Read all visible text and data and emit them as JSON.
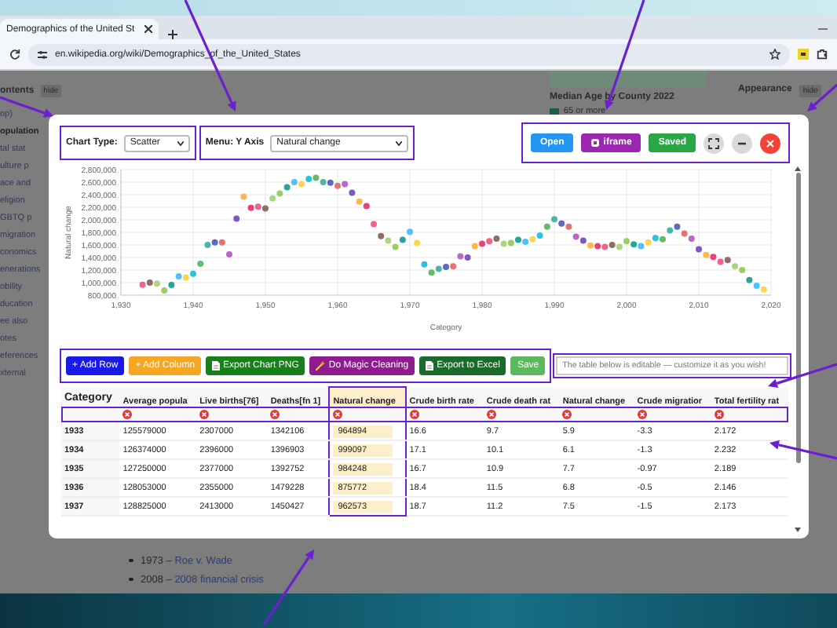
{
  "browser": {
    "tab_title": "Demographics of the United St",
    "url": "en.wikipedia.org/wiki/Demographics_of_the_United_States"
  },
  "page": {
    "contents_title": "ontents",
    "contents_hide": "hide",
    "sidebar_items": [
      {
        "label": "op)",
        "current": false
      },
      {
        "label": "opulation",
        "current": true
      },
      {
        "label": "tal stat",
        "current": false
      },
      {
        "label": "ulture p",
        "current": false
      },
      {
        "label": "ace and",
        "current": false
      },
      {
        "label": "eligion",
        "current": false
      },
      {
        "label": "GBTQ p",
        "current": false
      },
      {
        "label": "migration",
        "current": false
      },
      {
        "label": "conomics",
        "current": false
      },
      {
        "label": "enerations",
        "current": false
      },
      {
        "label": "obility",
        "current": false
      },
      {
        "label": "ducation",
        "current": false
      },
      {
        "label": "ee also",
        "current": false
      },
      {
        "label": "otes",
        "current": false
      },
      {
        "label": "eferences",
        "current": false
      },
      {
        "label": "xternal",
        "current": false
      }
    ],
    "figure_caption": "Median Age by County 2022",
    "legend_label": "65 or more",
    "appearance_title": "Appearance",
    "appearance_hide": "hide",
    "list_items": [
      {
        "prefix": "1973 –",
        "link": "Roe v. Wade"
      },
      {
        "prefix": "2008 –",
        "link": "2008 financial crisis"
      }
    ]
  },
  "modal": {
    "chart_type": {
      "label": "Chart Type:",
      "value": "Scatter",
      "framed": true
    },
    "y_axis": {
      "label": "Menu: Y Axis",
      "value": "Natural change",
      "framed": true
    },
    "header_buttons": {
      "framed": true,
      "items": [
        {
          "kind": "text",
          "label": "Open",
          "color": "#2196f3"
        },
        {
          "kind": "iframe",
          "label": "iframe",
          "color": "#9c27b0"
        },
        {
          "kind": "text",
          "label": "Saved",
          "color": "#28a745"
        },
        {
          "kind": "fullscreen",
          "color": "#d9d9d9"
        },
        {
          "kind": "minimize",
          "color": "#d9d9d9"
        },
        {
          "kind": "close",
          "color": "#f44336"
        }
      ]
    },
    "chart_data": {
      "type": "scatter",
      "grid": true,
      "xlabel": "Category",
      "ylabel": "Natural change",
      "x": [
        1933,
        1934,
        1935,
        1936,
        1937,
        1938,
        1939,
        1940,
        1941,
        1942,
        1943,
        1944,
        1945,
        1946,
        1947,
        1948,
        1949,
        1950,
        1951,
        1952,
        1953,
        1954,
        1955,
        1956,
        1957,
        1958,
        1959,
        1960,
        1961,
        1962,
        1963,
        1964,
        1965,
        1966,
        1967,
        1968,
        1969,
        1970,
        1971,
        1972,
        1973,
        1974,
        1975,
        1976,
        1977,
        1978,
        1979,
        1980,
        1981,
        1982,
        1983,
        1984,
        1985,
        1986,
        1987,
        1988,
        1989,
        1990,
        1991,
        1992,
        1993,
        1994,
        1995,
        1996,
        1997,
        1998,
        1999,
        2000,
        2001,
        2002,
        2003,
        2004,
        2005,
        2006,
        2007,
        2008,
        2009,
        2010,
        2011,
        2012,
        2013,
        2014,
        2015,
        2016,
        2017,
        2018,
        2019
      ],
      "series": [
        {
          "values": [
            965000,
            999000,
            984000,
            876000,
            963000,
            1100000,
            1080000,
            1140000,
            1300000,
            1600000,
            1640000,
            1640000,
            1450000,
            2020000,
            2370000,
            2190000,
            2210000,
            2180000,
            2340000,
            2420000,
            2520000,
            2600000,
            2570000,
            2650000,
            2670000,
            2600000,
            2590000,
            2540000,
            2570000,
            2430000,
            2290000,
            2220000,
            1930000,
            1740000,
            1670000,
            1570000,
            1680000,
            1810000,
            1630000,
            1290000,
            1160000,
            1220000,
            1250000,
            1260000,
            1420000,
            1400000,
            1580000,
            1620000,
            1660000,
            1700000,
            1620000,
            1630000,
            1680000,
            1650000,
            1690000,
            1750000,
            1890000,
            2010000,
            1940000,
            1890000,
            1730000,
            1670000,
            1590000,
            1580000,
            1570000,
            1600000,
            1570000,
            1660000,
            1610000,
            1580000,
            1640000,
            1710000,
            1690000,
            1830000,
            1890000,
            1780000,
            1700000,
            1530000,
            1440000,
            1410000,
            1330000,
            1360000,
            1260000,
            1200000,
            1040000,
            950000,
            890000
          ]
        }
      ],
      "xlim": [
        1930,
        2020
      ],
      "ylim": [
        800000,
        2800000
      ],
      "xticks": [
        {
          "value": 1930,
          "label": "1,930"
        },
        {
          "value": 1940,
          "label": "1,940"
        },
        {
          "value": 1950,
          "label": "1,950"
        },
        {
          "value": 1960,
          "label": "1,960"
        },
        {
          "value": 1970,
          "label": "1,970"
        },
        {
          "value": 1980,
          "label": "1,980"
        },
        {
          "value": 1990,
          "label": "1,990"
        },
        {
          "value": 2000,
          "label": "2,000"
        },
        {
          "value": 2010,
          "label": "2,010"
        },
        {
          "value": 2020,
          "label": "2,020"
        }
      ],
      "yticks": [
        {
          "value": 800000,
          "label": "800,000"
        },
        {
          "value": 1000000,
          "label": "1,000,000"
        },
        {
          "value": 1200000,
          "label": "1,200,000"
        },
        {
          "value": 1400000,
          "label": "1,400,000"
        },
        {
          "value": 1600000,
          "label": "1,600,000"
        },
        {
          "value": 1800000,
          "label": "1,800,000"
        },
        {
          "value": 2000000,
          "label": "2,000,000"
        },
        {
          "value": 2200000,
          "label": "2,200,000"
        },
        {
          "value": 2400000,
          "label": "2,400,000"
        },
        {
          "value": 2600000,
          "label": "2,600,000"
        },
        {
          "value": 2800000,
          "label": "2,800,000"
        }
      ]
    },
    "toolbar": {
      "framed": true,
      "buttons": [
        {
          "kind": "plain",
          "label": "+ Add Row",
          "color": "#1a1ae6"
        },
        {
          "kind": "plain",
          "label": "+ Add Column",
          "color": "#f5a623"
        },
        {
          "kind": "export",
          "label": "Export Chart PNG",
          "color": "#17801a"
        },
        {
          "kind": "magic",
          "label": "Do Magic Cleaning",
          "color": "#8e1c8e"
        },
        {
          "kind": "export",
          "label": "Export to Excel",
          "color": "#1a6b2a"
        },
        {
          "kind": "plain",
          "label": "Save",
          "color": "#5cb85c"
        }
      ]
    },
    "note": {
      "text": "The table below is editable — customize it as you wish!",
      "framed": true
    },
    "table": {
      "delete_row_framed": true,
      "columns": [
        {
          "label": "Category",
          "highlighted": false,
          "deletable": false
        },
        {
          "label": "Average popula",
          "highlighted": false,
          "deletable": true
        },
        {
          "label": "Live births[76]",
          "highlighted": false,
          "deletable": true
        },
        {
          "label": "Deaths[fn 1]",
          "highlighted": false,
          "deletable": true
        },
        {
          "label": "Natural change",
          "highlighted": true,
          "deletable": true
        },
        {
          "label": "Crude birth rate",
          "highlighted": false,
          "deletable": true
        },
        {
          "label": "Crude death rat",
          "highlighted": false,
          "deletable": true
        },
        {
          "label": "Natural change",
          "highlighted": false,
          "deletable": true
        },
        {
          "label": "Crude migratior",
          "highlighted": false,
          "deletable": true
        },
        {
          "label": "Total fertility rat",
          "highlighted": false,
          "deletable": true
        }
      ],
      "rows": [
        [
          "1933",
          "125579000",
          "2307000",
          "1342106",
          "964894",
          "16.6",
          "9.7",
          "5.9",
          "-3.3",
          "2.172"
        ],
        [
          "1934",
          "126374000",
          "2396000",
          "1396903",
          "999097",
          "17.1",
          "10.1",
          "6.1",
          "-1.3",
          "2.232"
        ],
        [
          "1935",
          "127250000",
          "2377000",
          "1392752",
          "984248",
          "16.7",
          "10.9",
          "7.7",
          "-0.97",
          "2.189"
        ],
        [
          "1936",
          "128053000",
          "2355000",
          "1479228",
          "875772",
          "18.4",
          "11.5",
          "6.8",
          "-0.5",
          "2.146"
        ],
        [
          "1937",
          "128825000",
          "2413000",
          "1450427",
          "962573",
          "18.7",
          "11.2",
          "7.5",
          "-1.5",
          "2.173"
        ]
      ]
    }
  }
}
